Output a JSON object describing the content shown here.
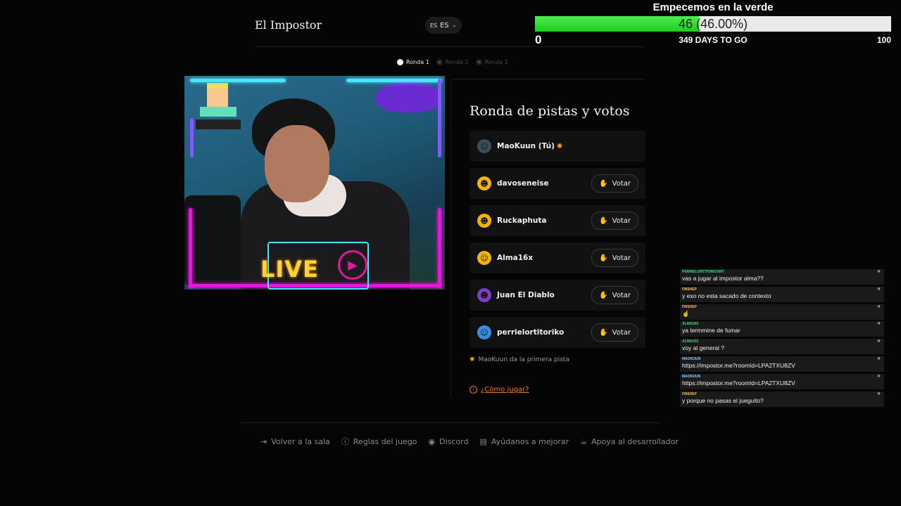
{
  "header": {
    "brand": "El Impostor",
    "lang_flag": "ES",
    "lang_code": "ES"
  },
  "goal": {
    "title": "Empecemos en la verde",
    "progress_label": "46 (46.00%)",
    "progress_fraction": 0.46,
    "min": "0",
    "days": "349 DAYS TO GO",
    "max": "100"
  },
  "rounds": [
    {
      "label": "Ronda 1",
      "active": true
    },
    {
      "label": "Ronda 2",
      "active": false
    },
    {
      "label": "Ronda 3",
      "active": false
    }
  ],
  "webcam": {
    "live_text": "LIVE"
  },
  "panel": {
    "title": "Ronda de pistas y votos",
    "vote_label": "Votar",
    "players": [
      {
        "name": "MaoKuun (Tú)",
        "avatar": "robot-icon",
        "avatar_color": "#3b4c5c",
        "avatar_glyph": "☺",
        "current": true
      },
      {
        "name": "davoseneise",
        "avatar": "cool-face-icon",
        "avatar_color": "#f4b400",
        "avatar_glyph": "☻",
        "current": false
      },
      {
        "name": "Ruckaphuta",
        "avatar": "sunglasses-face-icon",
        "avatar_color": "#f4b400",
        "avatar_glyph": "☻",
        "current": false
      },
      {
        "name": "Alma16x",
        "avatar": "heart-eyes-face-icon",
        "avatar_color": "#f4b400",
        "avatar_glyph": "☺",
        "current": false
      },
      {
        "name": "Juan El Diablo",
        "avatar": "devil-face-icon",
        "avatar_color": "#7b3fc6",
        "avatar_glyph": "☻",
        "current": false
      },
      {
        "name": "perrielortitoriko",
        "avatar": "cold-face-icon",
        "avatar_color": "#3a8de0",
        "avatar_glyph": "☺",
        "current": false
      }
    ],
    "clue_text": "MaoKuun da la primera pista",
    "how_to_play": "¿Cómo jugar?"
  },
  "footer": [
    {
      "label": "Volver a la sala",
      "icon": "exit-icon",
      "glyph": "⇥"
    },
    {
      "label": "Reglas del juego",
      "icon": "info-icon",
      "glyph": "ⓘ"
    },
    {
      "label": "Discord",
      "icon": "discord-icon",
      "glyph": "◉"
    },
    {
      "label": "Ayúdanos a mejorar",
      "icon": "feedback-icon",
      "glyph": "▤"
    },
    {
      "label": "Apoya al desarrollador",
      "icon": "coffee-icon",
      "glyph": "☕"
    }
  ],
  "chat": [
    {
      "user": "PERRIELORTITORIC0007",
      "user_color": "#3ddc84",
      "text": "vas a jugar al impostor alma??"
    },
    {
      "user": "FMSHEP",
      "user_color": "#f2c14e",
      "text": "y eso no esta sacado de contexto"
    },
    {
      "user": "FMSHEP",
      "user_color": "#f2c14e",
      "text": "☝"
    },
    {
      "user": "ALMA16X",
      "user_color": "#3ddc84",
      "text": "ya termmine de fumar"
    },
    {
      "user": "ALMA16X",
      "user_color": "#3ddc84",
      "text": "voy al general ?"
    },
    {
      "user": "MAOKUUN",
      "user_color": "#8fd0ff",
      "text": "https://impostor.me?roomId=LPA2TXU8ZV"
    },
    {
      "user": "MAOKUUN",
      "user_color": "#8fd0ff",
      "text": "https://impostor.me?roomId=LPA2TXU8ZV"
    },
    {
      "user": "FMSHEP",
      "user_color": "#f2c14e",
      "text": "y porque no pasas el jueguito?"
    }
  ]
}
